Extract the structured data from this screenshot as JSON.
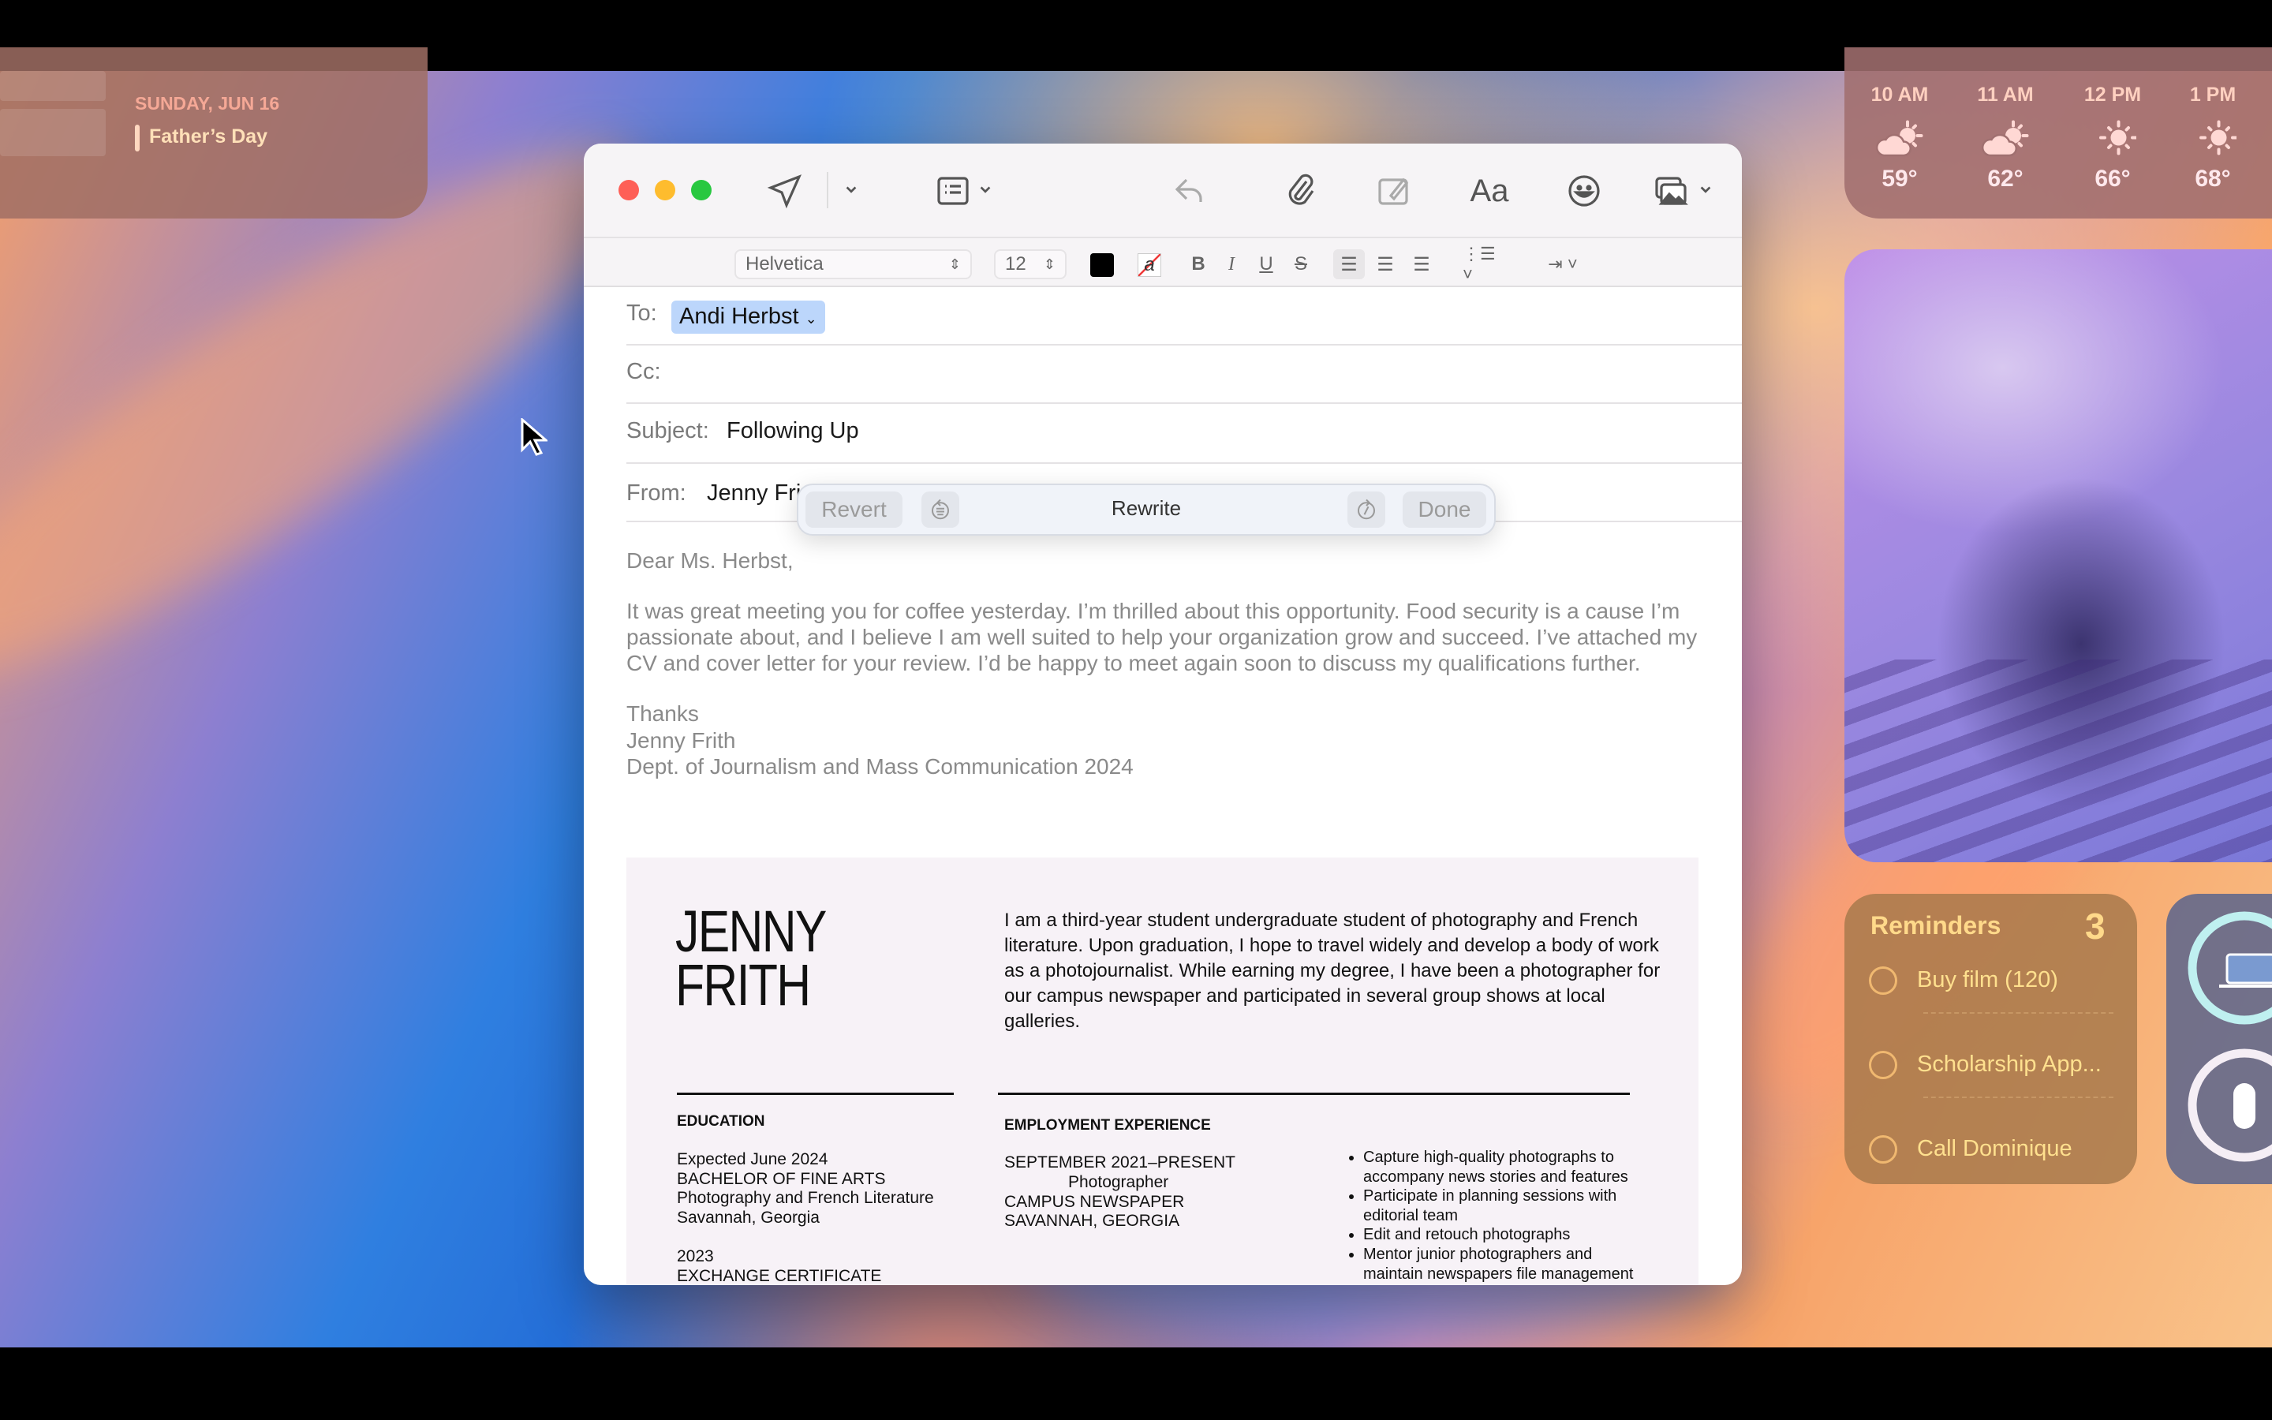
{
  "calendar_widget": {
    "date_header": "SUNDAY, JUN 16",
    "event": "Father’s Day"
  },
  "weather_widget": {
    "hours": [
      {
        "time": "10 AM",
        "icon": "partly-sunny-icon",
        "temp": "59°"
      },
      {
        "time": "11 AM",
        "icon": "partly-sunny-icon",
        "temp": "62°"
      },
      {
        "time": "12 PM",
        "icon": "sun-icon",
        "temp": "66°"
      },
      {
        "time": "1 PM",
        "icon": "sun-icon",
        "temp": "68°"
      }
    ]
  },
  "reminders_widget": {
    "title": "Reminders",
    "count": "3",
    "items": [
      "Buy film (120)",
      "Scholarship App...",
      "Call Dominique"
    ],
    "color": "#ffd98a"
  },
  "batteries_widget": {
    "devices": [
      "laptop-icon",
      "mouse-icon"
    ]
  },
  "mail": {
    "toolbar": {
      "icons": [
        "send-icon",
        "format-list-icon",
        "reply-icon",
        "attachment-icon",
        "markup-icon",
        "font-icon",
        "emoji-icon",
        "photo-browser-icon"
      ]
    },
    "format_bar": {
      "font": "Helvetica",
      "size": "12",
      "bold": "B",
      "italic": "I",
      "underline": "U",
      "strike": "S"
    },
    "to_label": "To:",
    "to_value": "Andi Herbst",
    "cc_label": "Cc:",
    "subject_label": "Subject:",
    "subject_value": "Following Up",
    "from_label": "From:",
    "from_value": "Jenny Fri",
    "rewrite": {
      "revert": "Revert",
      "title": "Rewrite",
      "done": "Done"
    },
    "body": {
      "greeting": "Dear Ms. Herbst,",
      "paragraph": "It was great meeting you for coffee yesterday. I’m thrilled about this opportunity. Food security is a cause I’m passionate about, and I believe I am well suited to help your organization grow and succeed. I’ve attached my CV and cover letter for your review. I’d be happy to meet again soon to discuss my qualifications further.",
      "sign_1": "Thanks",
      "sign_2": "Jenny Frith",
      "sign_3": "Dept. of Journalism and Mass Communication 2024"
    },
    "resume": {
      "name_1": "JENNY",
      "name_2": "FRITH",
      "summary": "I am a third-year student undergraduate student of photography and French literature. Upon graduation, I hope to travel widely and develop a body of work as a photojournalist. While earning my degree, I have been a photographer for our campus newspaper and participated in several group shows at local galleries.",
      "education_heading": "EDUCATION",
      "education": [
        "Expected June 2024",
        "BACHELOR OF FINE ARTS",
        "Photography and French Literature",
        "Savannah, Georgia"
      ],
      "education_2": [
        "2023",
        "EXCHANGE CERTIFICATE"
      ],
      "employment_heading": "EMPLOYMENT EXPERIENCE",
      "job_dates": "SEPTEMBER 2021–PRESENT",
      "job_title": "Photographer",
      "job_org": "CAMPUS NEWSPAPER",
      "job_location": "SAVANNAH, GEORGIA",
      "bullets": [
        "Capture high-quality photographs to accompany news stories and features",
        "Participate in planning sessions with editorial team",
        "Edit and retouch photographs",
        "Mentor junior photographers and maintain newspapers file management"
      ]
    }
  }
}
